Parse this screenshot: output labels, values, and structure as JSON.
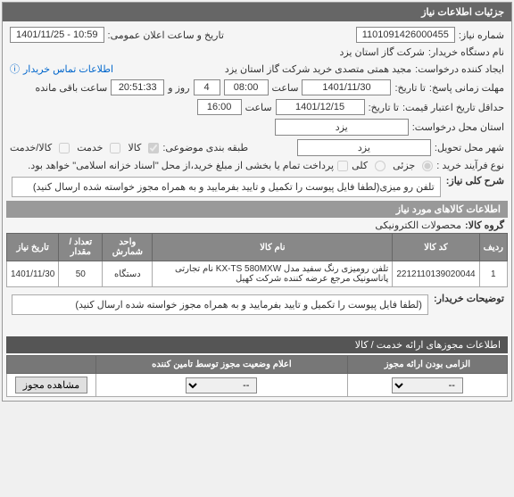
{
  "panel_title": "جزئیات اطلاعات نیاز",
  "fields": {
    "need_number_label": "شماره نیاز:",
    "need_number": "1101091426000455",
    "announce_date_label": "تاریخ و ساعت اعلان عمومی:",
    "announce_date": "1401/11/25 - 10:59",
    "buyer_device_label": "نام دستگاه خریدار:",
    "buyer_device": "شرکت گاز استان یزد",
    "requester_label": "ایجاد کننده درخواست:",
    "requester": "مجید همتی متصدی خرید شرکت گاز استان یزد",
    "contact_link": "اطلاعات تماس خریدار",
    "deadline_label": "مهلت زمانی پاسخ:",
    "deadline_prefix": "تا تاریخ:",
    "deadline_date": "1401/11/30",
    "deadline_time_label": "ساعت",
    "deadline_time": "08:00",
    "remaining_label": "ساعت باقی مانده",
    "remaining_days": "4",
    "remaining_and": "روز و",
    "remaining_time": "20:51:33",
    "min_validity_label": "حداقل تاریخ اعتبار قیمت:",
    "min_validity_prefix": "تا تاریخ:",
    "min_validity_date": "1401/12/15",
    "min_validity_time_label": "ساعت",
    "min_validity_time": "16:00",
    "request_location_label": "استان محل درخواست:",
    "request_location": "یزد",
    "delivery_location_label": "شهر محل تحویل:",
    "delivery_location": "یزد",
    "subject_classification_label": "طبقه بندی موضوعی:",
    "cb_goods": "کالا",
    "cb_service": "خدمت",
    "cb_goods_service": "کالا/خدمت",
    "buy_process_label": "نوع فرآیند خرید :",
    "cb_partial": "جزئی",
    "cb_full": "کلی",
    "buy_note": "پرداخت تمام یا بخشی از مبلغ خرید،از محل \"اسناد خزانه اسلامی\" خواهد بود."
  },
  "general_desc": {
    "label": "شرح کلی نیاز:",
    "text": "تلفن رو میزی(لطفا فایل پیوست را تکمیل و تایید بفرمایید و به همراه مجوز خواسته شده ارسال کنید)"
  },
  "goods_section": {
    "header": "اطلاعات کالاهای مورد نیاز",
    "group_label": "گروه کالا:",
    "group_value": "محصولات الکترونیکی"
  },
  "table": {
    "headers": [
      "ردیف",
      "کد کالا",
      "نام کالا",
      "واحد شمارش",
      "تعداد / مقدار",
      "تاریخ نیاز"
    ],
    "rows": [
      {
        "idx": "1",
        "code": "2212110139020044",
        "name": "تلفن رومیزی رنگ سفید مدل KX-TS 580MXW نام تجارتی پاناسونیک مرجع عرضه کننده شرکت کهیل",
        "unit": "دستگاه",
        "qty": "50",
        "date": "1401/11/30"
      }
    ]
  },
  "buyer_notes": {
    "label": "توضیحات خریدار:",
    "text": "(لطفا فایل پیوست را تکمیل و تایید بفرمایید و به همراه مجوز خواسته شده ارسال کنید)"
  },
  "permits_header": "اطلاعات مجوزهای ارائه خدمت / کالا",
  "footer": {
    "required_label": "الزامی بودن ارائه مجوز",
    "status_label": "اعلام وضعیت مجوز توسط تامین کننده",
    "select_placeholder": "--",
    "view_btn": "مشاهده مجوز"
  }
}
